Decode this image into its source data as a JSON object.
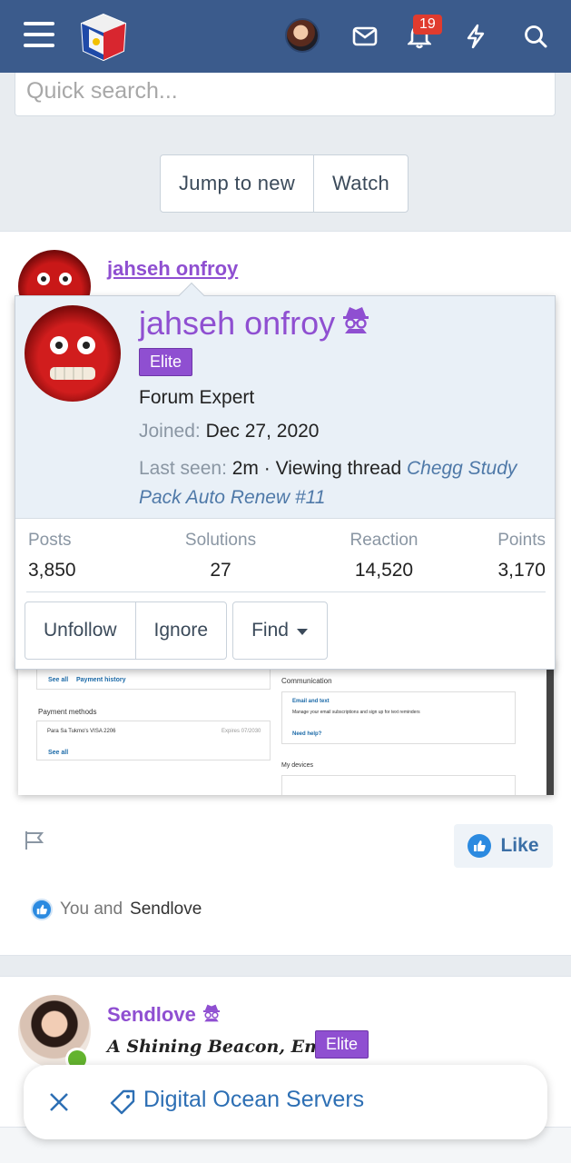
{
  "topbar": {
    "notification_count": "19"
  },
  "search": {
    "placeholder": "Quick search..."
  },
  "thread_actions": {
    "jump_label": "Jump to new",
    "watch_label": "Watch"
  },
  "post": {
    "username": "jahseh onfroy",
    "like_label": "Like",
    "reactions_prefix": "You and",
    "reactions_name": "Sendlove"
  },
  "popup": {
    "username": "jahseh onfroy",
    "badge": "Elite",
    "title": "Forum Expert",
    "joined_label": "Joined:",
    "joined_value": "Dec 27, 2020",
    "last_seen_label": "Last seen:",
    "last_seen_value": "2m · Viewing thread",
    "last_seen_thread": "Chegg Study Pack Auto Renew #11",
    "stats": [
      {
        "label": "Posts",
        "value": "3,850"
      },
      {
        "label": "Solutions",
        "value": "27"
      },
      {
        "label": "Reaction",
        "value": "14,520"
      },
      {
        "label": "Points",
        "value": "3,170"
      }
    ],
    "buttons": {
      "unfollow": "Unfollow",
      "ignore": "Ignore",
      "find": "Find"
    }
  },
  "embedded_screenshot": {
    "see_all_1": "See all",
    "payment_history": "Payment history",
    "payment_methods": "Payment methods",
    "card_line": "Para Sa Tukmo's VISA 2206",
    "card_expires": "Expires 07/2030",
    "see_all_2": "See all",
    "communication": "Communication",
    "email_text": "Email and text",
    "email_desc": "Manage your email subscriptions and sign up for text reminders",
    "need_help": "Need help?",
    "my_devices": "My devices"
  },
  "post2": {
    "username": "Sendlove",
    "user_title": "A Shining Beacon, Empath",
    "badge": "Elite"
  },
  "tag_chip": {
    "label": "Digital Ocean Servers"
  },
  "colors": {
    "header": "#3b5b8c",
    "username": "#8f4fd1",
    "link": "#2d6fb4"
  }
}
